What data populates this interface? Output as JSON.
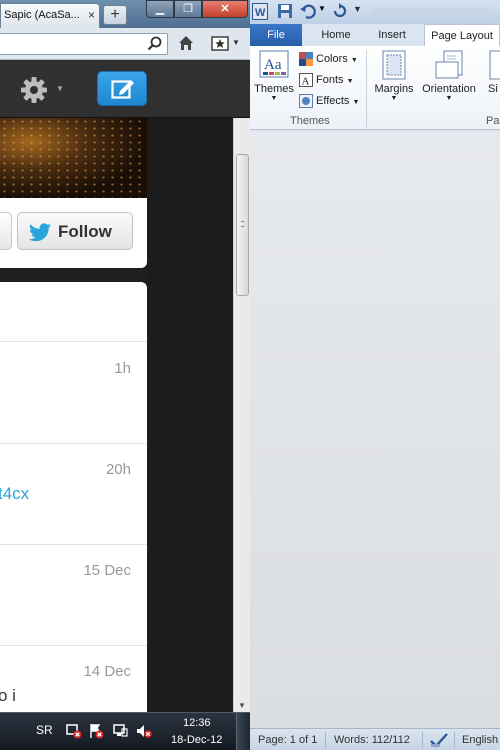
{
  "browser": {
    "tab_title": "Sapic (AcaSa...",
    "tab_close": "×",
    "new_tab": "+",
    "window_controls": {
      "minimize": "▁",
      "maximize": "❐",
      "close": "✕"
    },
    "icons": {
      "search": "search-icon",
      "home": "home-icon",
      "bookmarks": "bookmark-icon"
    }
  },
  "twitter": {
    "follow_label": "Follow",
    "tweets": [
      {
        "time": "1h",
        "text": ""
      },
      {
        "time": "20h",
        "text": "t4cx"
      },
      {
        "time": "15 Dec",
        "text": ""
      },
      {
        "time": "14 Dec",
        "text": "o i"
      }
    ],
    "colors": {
      "accent": "#2aa5dc",
      "compose": "#2a96de"
    }
  },
  "taskbar": {
    "language": "SR",
    "time": "12:36",
    "date": "18-Dec-12"
  },
  "word": {
    "tabs": {
      "file": "File",
      "home": "Home",
      "insert": "Insert",
      "page_layout": "Page Layout"
    },
    "ribbon": {
      "themes": "Themes",
      "colors": "Colors",
      "fonts": "Fonts",
      "effects": "Effects",
      "themes_group": "Themes",
      "margins": "Margins",
      "orientation": "Orientation",
      "size_partial": "Si",
      "page_group_partial": "Pa"
    },
    "status": {
      "page": "Page: 1 of 1",
      "words": "Words: 112/112",
      "language": "English"
    }
  }
}
